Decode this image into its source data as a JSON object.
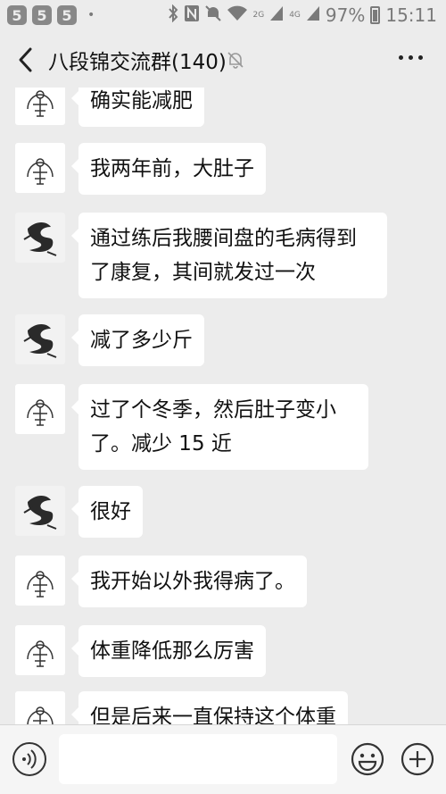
{
  "status": {
    "left_badges": [
      "5",
      "5",
      "5"
    ],
    "dot": "•",
    "signal_label": "2G",
    "signal_label2": "4G",
    "battery": "97%",
    "time": "15:11"
  },
  "header": {
    "title": "八段锦交流群(140)"
  },
  "messages": [
    {
      "avatar": "ring-avatar",
      "text": "确实能减肥"
    },
    {
      "avatar": "ring-avatar",
      "text": "我两年前，大肚子"
    },
    {
      "avatar": "ink-avatar",
      "text": "通过练后我腰间盘的毛病得到了康复，其间就发过一次"
    },
    {
      "avatar": "ink-avatar",
      "text": "减了多少斤"
    },
    {
      "avatar": "ring-avatar",
      "text": "过了个冬季，然后肚子变小了。减少 15 近"
    },
    {
      "avatar": "ink-avatar",
      "text": "很好"
    },
    {
      "avatar": "ring-avatar",
      "text": "我开始以外我得病了。"
    },
    {
      "avatar": "ring-avatar",
      "text": "体重降低那么厉害"
    },
    {
      "avatar": "ring-avatar",
      "text": "但是后来一直保持这个体重"
    }
  ],
  "input": {
    "placeholder": ""
  }
}
